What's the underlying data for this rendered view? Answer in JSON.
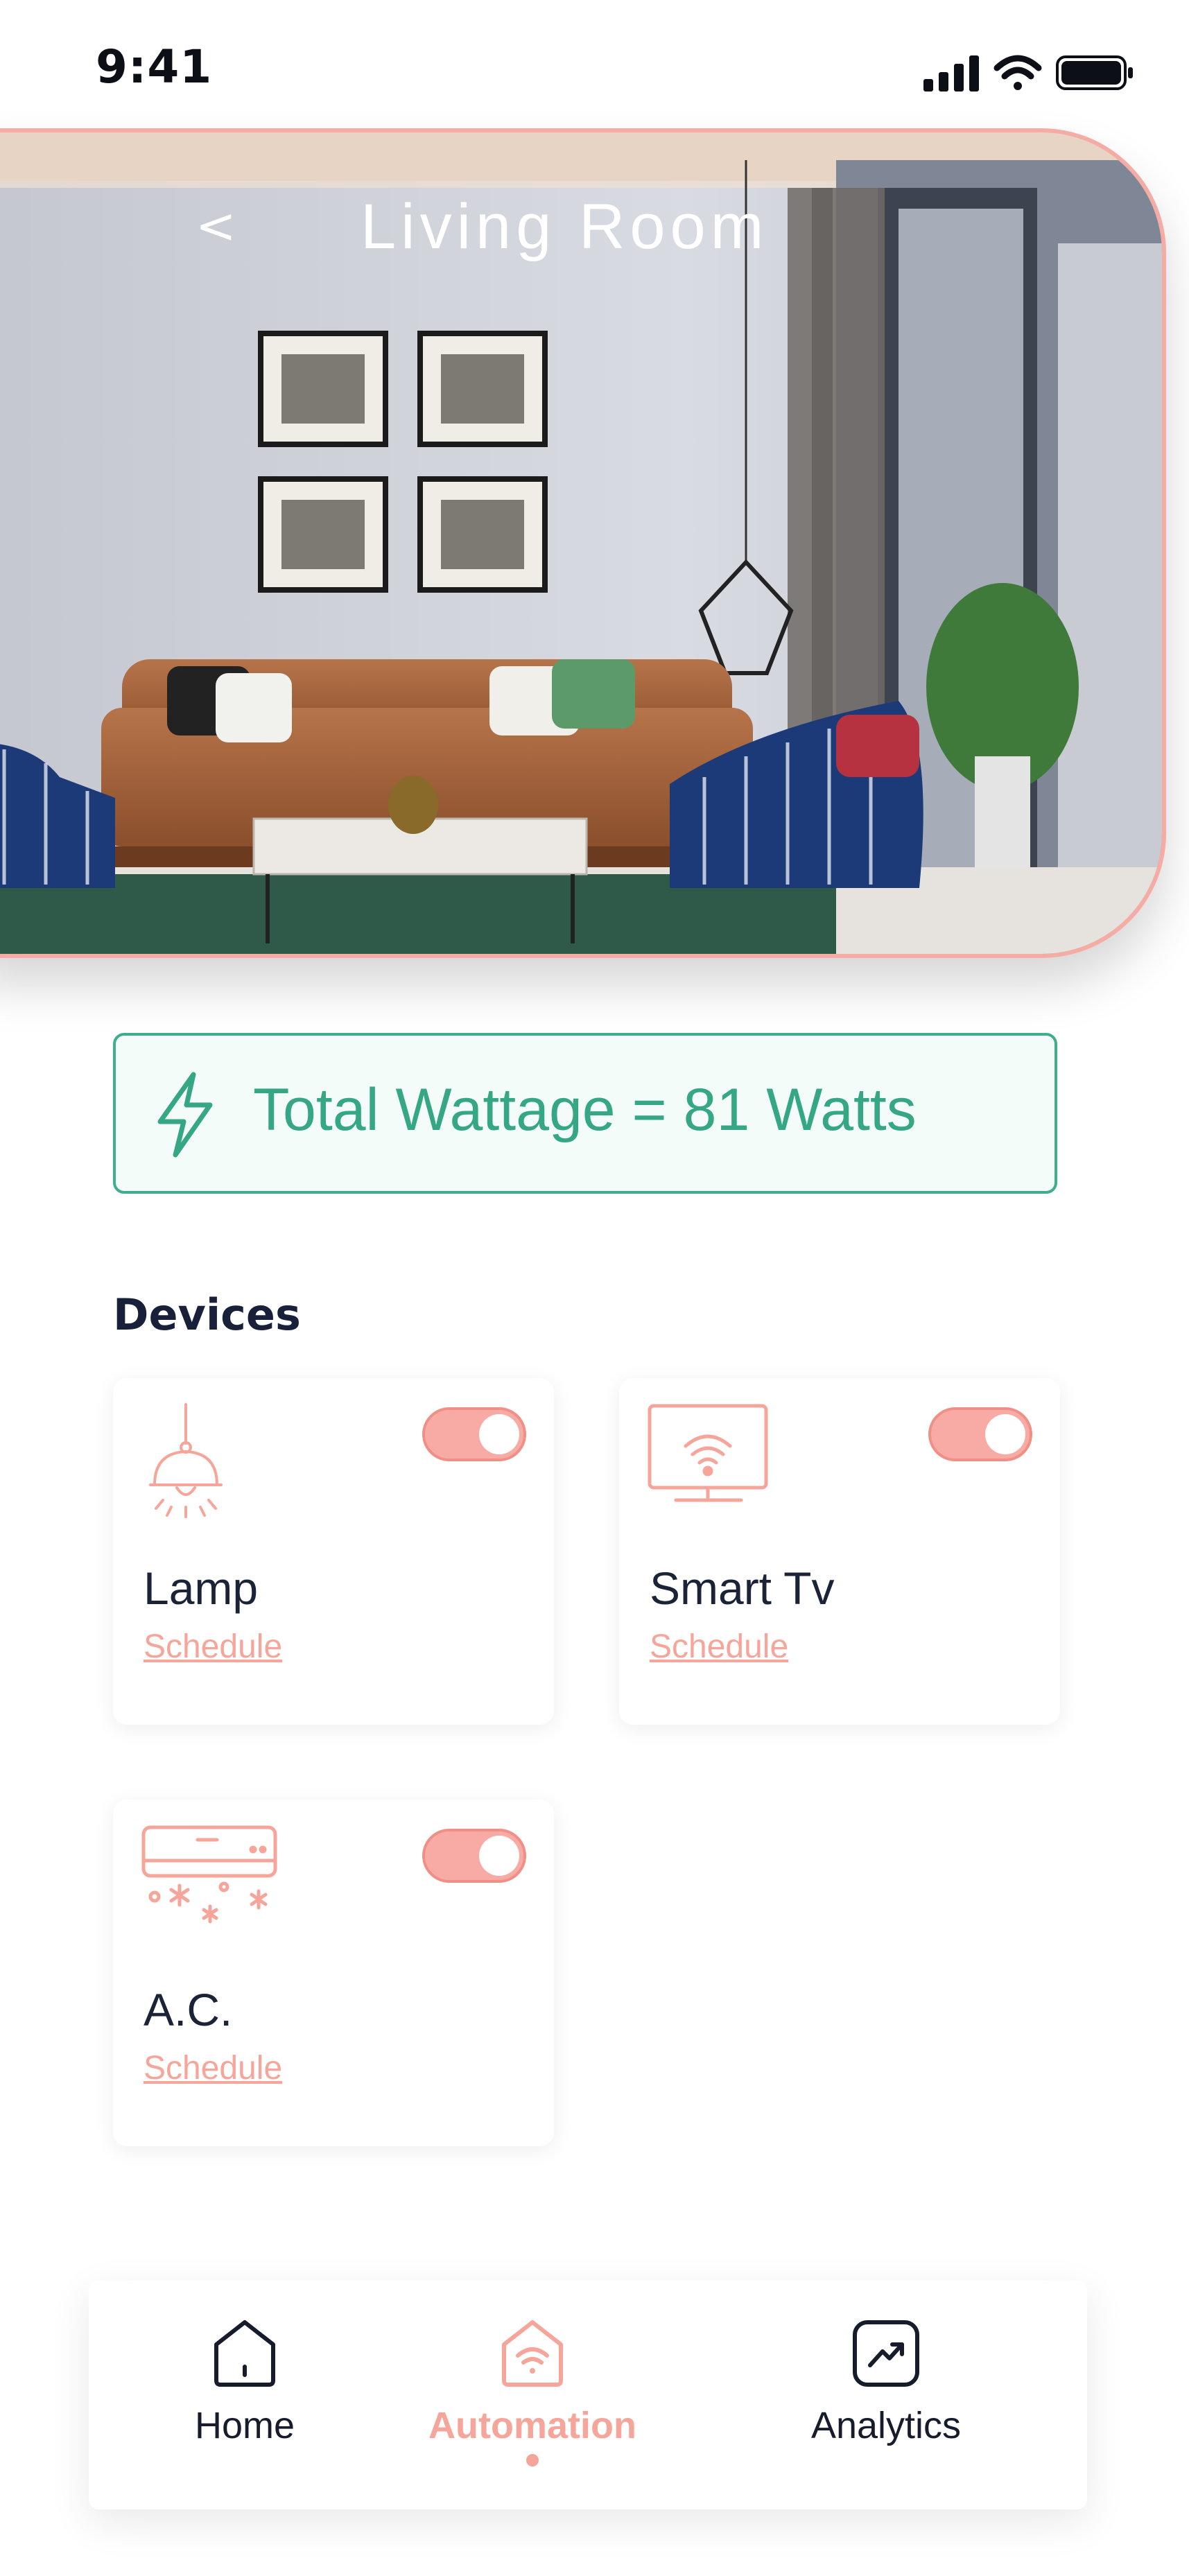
{
  "status_bar": {
    "time": "9:41",
    "icons": [
      "signal-icon",
      "wifi-icon",
      "battery-icon"
    ]
  },
  "header": {
    "back_label": "<",
    "title": "Living Room"
  },
  "wattage": {
    "text": "Total Wattage = 81 Watts",
    "icon": "bolt-icon"
  },
  "devices": {
    "heading": "Devices",
    "items": [
      {
        "name": "Lamp",
        "schedule_label": "Schedule",
        "icon": "lamp-icon",
        "on": true
      },
      {
        "name": "Smart Tv",
        "schedule_label": "Schedule",
        "icon": "smart-tv-icon",
        "on": true
      },
      {
        "name": "A.C.",
        "schedule_label": "Schedule",
        "icon": "air-conditioner-icon",
        "on": true
      }
    ]
  },
  "nav": {
    "items": [
      {
        "label": "Home",
        "icon": "home-icon",
        "active": false
      },
      {
        "label": "Automation",
        "icon": "automation-icon",
        "active": true
      },
      {
        "label": "Analytics",
        "icon": "analytics-icon",
        "active": false
      }
    ]
  },
  "colors": {
    "accent": "#f6a59b",
    "green": "#35a784",
    "dark": "#1b2338"
  }
}
